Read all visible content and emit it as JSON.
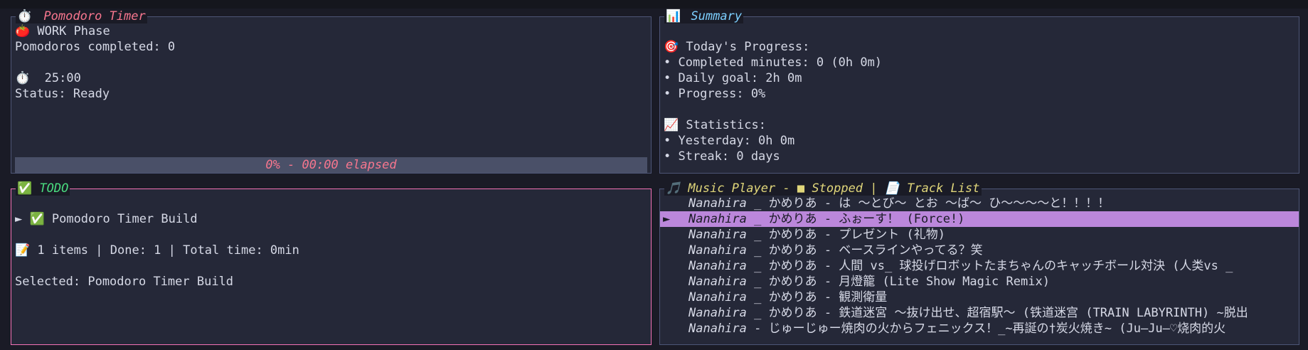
{
  "colors": {
    "background": "#1a1b26",
    "panel_bg": "#252838",
    "pomodoro_title": "#f7768e",
    "summary_title": "#7dcfff",
    "todo_title": "#4ade80",
    "todo_border": "#f472b6",
    "music_title": "#e0d67a",
    "selected_track_bg": "#bb87db"
  },
  "pomodoro": {
    "icon": "⏱️",
    "title": "Pomodoro Timer",
    "phase": "🍅 WORK Phase",
    "completed": "Pomodoros completed: 0",
    "timer": "⏱️  25:00",
    "status": "Status: Ready",
    "progress": 0,
    "progress_label": "0% - 00:00 elapsed"
  },
  "summary": {
    "icon": "📊",
    "title": "Summary",
    "today_header": "🎯 Today's Progress:",
    "completed_minutes": "• Completed minutes: 0 (0h 0m)",
    "daily_goal": "• Daily goal: 2h 0m",
    "progress": "• Progress: 0%",
    "stats_header": "📈 Statistics:",
    "yesterday": "• Yesterday: 0h 0m",
    "streak": "• Streak: 0 days"
  },
  "todo": {
    "icon": "✅",
    "title": "TODO",
    "item": "► ✅ Pomodoro Timer Build",
    "stats": "📝 1 items | Done: 1 | Total time: 0min",
    "selected": "Selected: Pomodoro Timer Build"
  },
  "music": {
    "title": "🎵 Music Player - ■ Stopped | 📄 Track List",
    "selected_marker": "►",
    "tracks": [
      {
        "artist": "Nanahira",
        "title": " _ かめりあ - は ～とび～ とお ～ば～ ひ～～～～と！！！！"
      },
      {
        "artist": "Nanahira",
        "title": " _ かめりあ - ふぉーす！ (Force!)"
      },
      {
        "artist": "Nanahira",
        "title": " _ かめりあ - プレゼント (礼物)"
      },
      {
        "artist": "Nanahira",
        "title": " _ かめりあ - ベースラインやってる？笑"
      },
      {
        "artist": "Nanahira",
        "title": " _ かめりあ - 人間 vs_ 球投げロボットたまちゃんのキャッチボール対決 (人类vs _"
      },
      {
        "artist": "Nanahira",
        "title": " _ かめりあ - 月燈籠 (Lite Show Magic Remix)"
      },
      {
        "artist": "Nanahira",
        "title": " _ かめりあ - 観測衛量"
      },
      {
        "artist": "Nanahira",
        "title": " _ かめりあ - 鉄道迷宮 ～抜け出せ、超宿駅～ (铁道迷宫 (TRAIN LABYRINTH) ~脱出"
      },
      {
        "artist": "Nanahira",
        "title": " - じゅーじゅー焼肉の火からフェニックス！_~再誕の†炭火焼き~ (Ju—Ju—♡烧肉的火"
      }
    ]
  }
}
